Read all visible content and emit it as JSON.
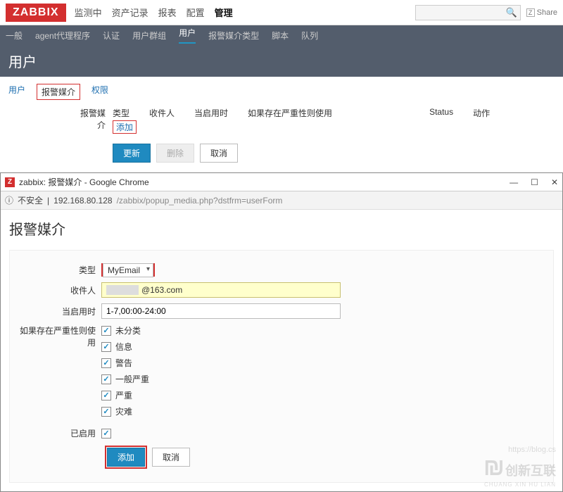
{
  "brand": "ZABBIX",
  "share_label": "Share",
  "mainnav": {
    "items": [
      "监测中",
      "资产记录",
      "报表",
      "配置",
      "管理"
    ],
    "active_index": 4
  },
  "subnav": {
    "items": [
      "一般",
      "agent代理程序",
      "认证",
      "用户群组",
      "用户",
      "报警媒介类型",
      "脚本",
      "队列"
    ],
    "active_index": 4
  },
  "page_title": "用户",
  "tabs": {
    "items": [
      "用户",
      "报警媒介",
      "权限"
    ],
    "active_index": 1
  },
  "media_section": {
    "label": "报警媒介",
    "columns": [
      "类型",
      "收件人",
      "当启用时",
      "如果存在严重性则使用",
      "Status",
      "动作"
    ],
    "add_link": "添加",
    "buttons": {
      "update": "更新",
      "delete": "删除",
      "cancel": "取消"
    }
  },
  "popup": {
    "window_title": "zabbix: 报警媒介 - Google Chrome",
    "security_label": "不安全",
    "url_host": "192.168.80.128",
    "url_path": "/zabbix/popup_media.php?dstfrm=userForm",
    "heading": "报警媒介",
    "fields": {
      "type_label": "类型",
      "type_value": "MyEmail",
      "recipient_label": "收件人",
      "recipient_value_suffix": "@163.com",
      "when_label": "当启用时",
      "when_value": "1-7,00:00-24:00",
      "severity_label": "如果存在严重性则使用",
      "severities": [
        "未分类",
        "信息",
        "警告",
        "一般严重",
        "严重",
        "灾难"
      ],
      "enabled_label": "已启用",
      "enabled_checked": true
    },
    "buttons": {
      "add": "添加",
      "cancel": "取消"
    }
  },
  "watermark": {
    "line1": "https://blog.cs",
    "brand_cn": "创新互联",
    "brand_py": "CHUANG XIN HU LIAN"
  }
}
